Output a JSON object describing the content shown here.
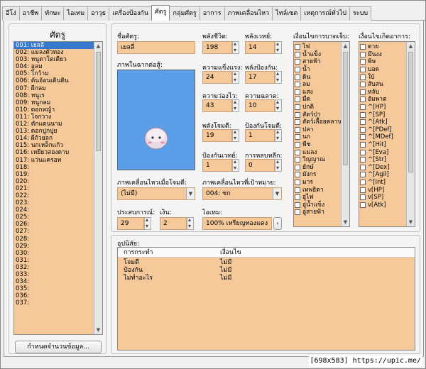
{
  "tabs": [
    "อีโง่",
    "อาชีพ",
    "ทักษะ",
    "ไอเทม",
    "อาวุธ",
    "เครื่องป้องกัน",
    "ศัตรู",
    "กลุ่มศัตรู",
    "อาการ",
    "ภาพเคลื่อนไหว",
    "ไทล์เซต",
    "เหตุการณ์ทั่วไป",
    "ระบบ"
  ],
  "enemy_list": {
    "title": "ศัตรู",
    "items": [
      "001: เยลลี่",
      "002: แมลงตัวทอง",
      "003: หนูตาโตเดียว",
      "004: อูลม",
      "005: โกว้าม",
      "006: ต้นอ้อนเดินดิน",
      "007: ผีกลม",
      "008: หนูเร",
      "009: หนูกลม",
      "010: ดอกหญ้า",
      "011: โจกวาง",
      "012: ตักแตนนาม",
      "013: ดอกปูกปูย",
      "014: ผีถ้วยลก",
      "015: นกเหล็กแก้ว",
      "016: เหยียวสองดาบ",
      "017: แว่นแครอท",
      "018:",
      "019:",
      "020:",
      "021:",
      "022:",
      "023:",
      "024:",
      "025:",
      "026:",
      "027:",
      "028:",
      "029:",
      "030:",
      "031:",
      "032:",
      "033:",
      "034:",
      "035:",
      "036:",
      "037:"
    ],
    "selected_index": 0,
    "set_count_button": "กำหนดจำนวนข้อมูล..."
  },
  "fields": {
    "name_label": "ชื่อศัตรู:",
    "name_value": "เยลลี่",
    "image_label": "ภาพในฉากต่อสู้:",
    "hp_label": "พลังชีวิต:",
    "hp_value": "198",
    "mp_label": "พลังเวทย์:",
    "mp_value": "14",
    "atk_label": "ความแข็งแรง:",
    "atk_value": "24",
    "def_label": "พลังป้องกัน:",
    "def_value": "17",
    "agi_label": "ความว่องไว:",
    "agi_value": "43",
    "int_label": "ความฉลาด:",
    "int_value": "10",
    "pwr_label": "พลังโจมตี:",
    "pwr_value": "19",
    "pdef_label": "ป้องกันโจมตี:",
    "pdef_value": "1",
    "mdef_label": "ป้องกันเวทย์:",
    "mdef_value": "1",
    "eva_label": "การหลบหลีก:",
    "eva_value": "0",
    "attacker_anim_label": "ภาพเคลื่อนไหวเมื่อโจมตี:",
    "attacker_anim_value": "(ไม่มี)",
    "target_anim_label": "ภาพเคลื่อนไหวที่เป้าหมาย:",
    "target_anim_value": "004: ชก",
    "exp_label": "ประสบการณ์:",
    "exp_value": "29",
    "gold_label": "เงิน:",
    "gold_value": "2",
    "item_label": "ไอเทม:",
    "item_value": "100% เหรียญทองแดง"
  },
  "element_list": {
    "title": "เงื่อนไขการบาดเจ็บ:",
    "items": [
      "ไฟ",
      "น้ำแข็ง",
      "สายฟ้า",
      "น้ำ",
      "ดิน",
      "ลม",
      "แสง",
      "มืด",
      "ปกติ",
      "สัตว์ป่า",
      "สัตว์เลื้อยคลาน",
      "ปลา",
      "นก",
      "พืช",
      "แมลง",
      "วิญญาณ",
      "ยักษ์",
      "มังกร",
      "มาร",
      "เทพธิดา",
      "อู่ไฟ",
      "อู่น้ำแข็ง",
      "อู่สายฟ้า"
    ]
  },
  "state_list": {
    "title": "เงื่อนไขเกิดอาการ:",
    "items": [
      "ตาย",
      "มึนงง",
      "พิษ",
      "บอด",
      "ใบ้",
      "สับสน",
      "หลับ",
      "อัมพาต",
      "^[HP]",
      "^[SP]",
      "^[Atk]",
      "^[PDef]",
      "^[MDef]",
      "^[Hit]",
      "^[Eva]",
      "^[Str]",
      "^[Dex]",
      "^[Agil]",
      "^[Int]",
      "v[HP]",
      "v[SP]",
      "v[Atk]"
    ]
  },
  "actions": {
    "title": "อุปนิสัย:",
    "col_action": "การกระทำ",
    "col_condition": "เงื่อนไข",
    "rows": [
      {
        "action": "โจมตี",
        "condition": "ไม่มี"
      },
      {
        "action": "ป้องกัน",
        "condition": "ไม่มี"
      },
      {
        "action": "ไม่ทำอะไร",
        "condition": "ไม่มี"
      }
    ]
  },
  "watermark": "[698x583]  https://upic.me/",
  "colors": {
    "field_bg": "#f6c99a",
    "selection": "#3478d0",
    "preview_bg": "#5b9ee8"
  }
}
